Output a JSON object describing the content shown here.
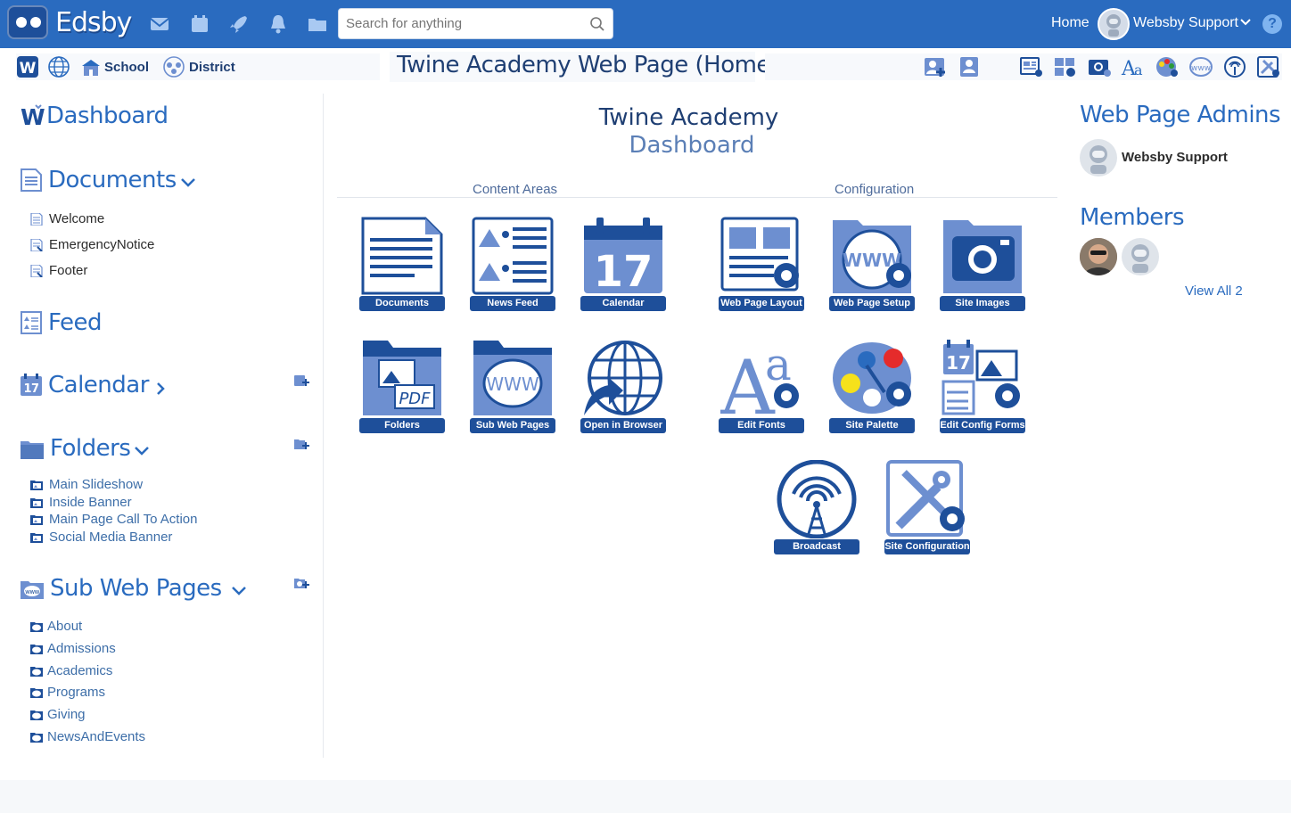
{
  "app": {
    "name": "Edsby"
  },
  "topbar": {
    "search_placeholder": "Search for anything",
    "home_label": "Home",
    "user_name": "Websby Support",
    "help_label": "?"
  },
  "subbar": {
    "school_label": "School",
    "district_label": "District",
    "page_title": "Twine Academy Web Page (Home)"
  },
  "sidebar": {
    "dashboard": "Dashboard",
    "documents": {
      "label": "Documents",
      "items": [
        "Welcome",
        "EmergencyNotice",
        "Footer"
      ]
    },
    "feed": "Feed",
    "calendar": "Calendar",
    "folders": {
      "label": "Folders",
      "items": [
        "Main Slideshow",
        "Inside Banner",
        "Main Page Call To Action",
        "Social Media Banner"
      ]
    },
    "subpages": {
      "label": "Sub Web Pages",
      "items": [
        "About",
        "Admissions",
        "Academics",
        "Programs",
        "Giving",
        "NewsAndEvents"
      ]
    }
  },
  "main": {
    "title": "Twine Academy",
    "subtitle": "Dashboard",
    "content_areas_label": "Content Areas",
    "configuration_label": "Configuration",
    "tiles": {
      "documents": "Documents",
      "news_feed": "News Feed",
      "calendar": "Calendar",
      "calendar_number": "17",
      "web_page_layout": "Web Page Layout",
      "web_page_setup": "Web Page Setup",
      "site_images": "Site Images",
      "folders": "Folders",
      "folders_pdf": "PDF",
      "sub_web_pages": "Sub Web Pages",
      "www": "WWW",
      "open_in_browser": "Open in Browser",
      "edit_fonts": "Edit Fonts",
      "site_palette": "Site Palette",
      "edit_config_forms": "Edit Config Forms",
      "broadcast": "Broadcast",
      "site_configuration": "Site Configuration"
    }
  },
  "rightcol": {
    "admins_title": "Web Page Admins",
    "admin_name": "Websby Support",
    "members_title": "Members",
    "view_all": "View All 2"
  },
  "colors": {
    "brand_blue": "#2a6bbf",
    "dark_blue": "#1e4f9a",
    "icon_fill": "#6d8fd0",
    "link_blue": "#3d6ea8",
    "title_navy": "#1f3f73"
  }
}
